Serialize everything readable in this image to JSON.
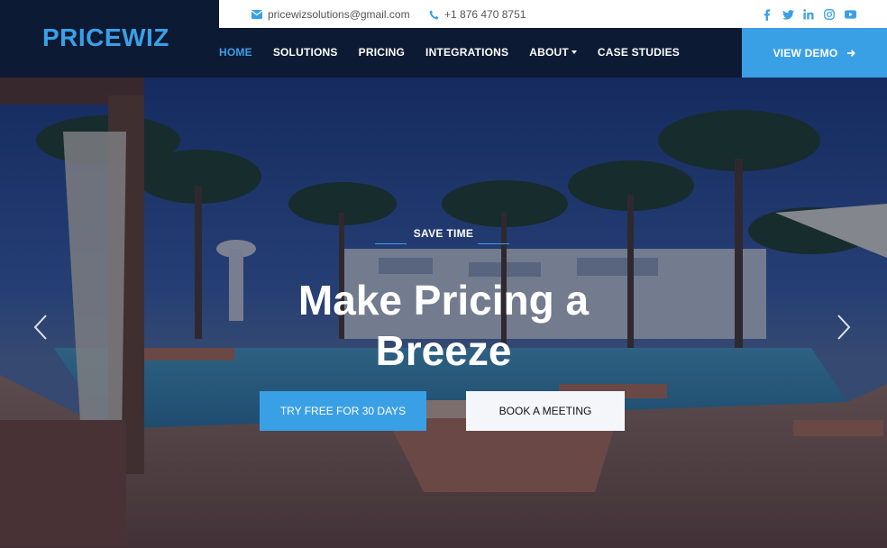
{
  "brand": {
    "logo_text": "PRICEWIZ",
    "accent": "#3aa0e6",
    "dark": "#0d1a33"
  },
  "topbar": {
    "email": "pricewizsolutions@gmail.com",
    "phone": "+1 876 470 8751",
    "social_icons": [
      "facebook-icon",
      "twitter-icon",
      "linkedin-icon",
      "instagram-icon",
      "youtube-icon"
    ]
  },
  "nav": {
    "items": [
      {
        "label": "HOME",
        "active": true
      },
      {
        "label": "SOLUTIONS"
      },
      {
        "label": "PRICING"
      },
      {
        "label": "INTEGRATIONS"
      },
      {
        "label": "ABOUT",
        "dropdown": true
      },
      {
        "label": "CASE STUDIES"
      }
    ],
    "cta_label": "VIEW DEMO"
  },
  "hero": {
    "kicker": "SAVE TIME",
    "headline_line1": "Make Pricing a",
    "headline_line2": "Breeze",
    "primary_button": "TRY FREE FOR 30 DAYS",
    "secondary_button": "BOOK A MEETING"
  }
}
